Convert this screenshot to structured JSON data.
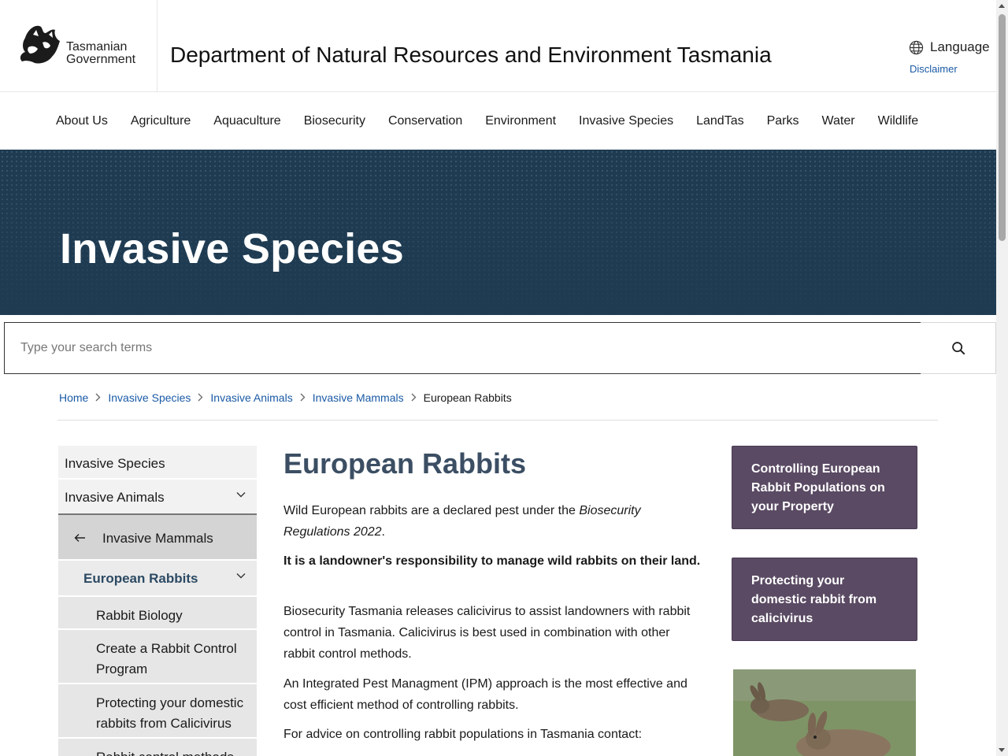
{
  "header": {
    "logo_line1": "Tasmanian",
    "logo_line2": "Government",
    "site_title": "Department of Natural Resources and Environment Tasmania",
    "language_label": "Language",
    "disclaimer_label": "Disclaimer"
  },
  "nav": {
    "items": [
      {
        "label": "About Us"
      },
      {
        "label": "Agriculture"
      },
      {
        "label": "Aquaculture"
      },
      {
        "label": "Biosecurity"
      },
      {
        "label": "Conservation"
      },
      {
        "label": "Environment"
      },
      {
        "label": "Invasive Species"
      },
      {
        "label": "LandTas"
      },
      {
        "label": "Parks"
      },
      {
        "label": "Water"
      },
      {
        "label": "Wildlife"
      }
    ]
  },
  "hero": {
    "title": "Invasive Species"
  },
  "search": {
    "placeholder": "Type your search terms"
  },
  "breadcrumb": {
    "items": [
      {
        "label": "Home"
      },
      {
        "label": "Invasive Species"
      },
      {
        "label": "Invasive Animals"
      },
      {
        "label": "Invasive Mammals"
      }
    ],
    "current": "European Rabbits"
  },
  "sidebar": {
    "level1": "Invasive Species",
    "level2": "Invasive Animals",
    "back_item": "Invasive Mammals",
    "active_item": "European Rabbits",
    "sub_items": [
      {
        "label": "Rabbit Biology"
      },
      {
        "label": "Create a Rabbit Control Program"
      },
      {
        "label": "Protecting your domestic rabbits from Calicivirus"
      },
      {
        "label": "Rabbit control methods"
      }
    ]
  },
  "main": {
    "title": "European Rabbits",
    "p1_text": "Wild European rabbits are a declared pest under the ",
    "p1_italic": "Biosecurity Regulations 2022",
    "p1_end": ".",
    "p2_bold": "It is a landowner's responsibility to manage wild rabbits on their land.",
    "p3": "Biosecurity Tasmania releases calicivirus to assist landowners with rabbit control in Tasmania. Calicivirus is best used in combination with other rabbit control methods.",
    "p4": "An Integrated Pest Managment (IPM) approach is the most effective and cost efficient method of controlling rabbits.",
    "p5": "For advice on controlling rabbit populations in Tasmania contact:"
  },
  "cards": [
    {
      "label": "Controlling European Rabbit Populations on your Property"
    },
    {
      "label": "Protecting your domestic rabbit from calicivirus"
    }
  ],
  "colors": {
    "hero_bg": "#1e3b52",
    "card_bg": "#5a4a63",
    "link": "#1a5aa6",
    "title": "#3b4e63"
  },
  "icons": {
    "language": "globe-icon",
    "search": "search-icon",
    "back": "arrow-left-icon",
    "expand": "chevron-down-icon",
    "breadcrumb_separator": "chevron-right-icon"
  }
}
